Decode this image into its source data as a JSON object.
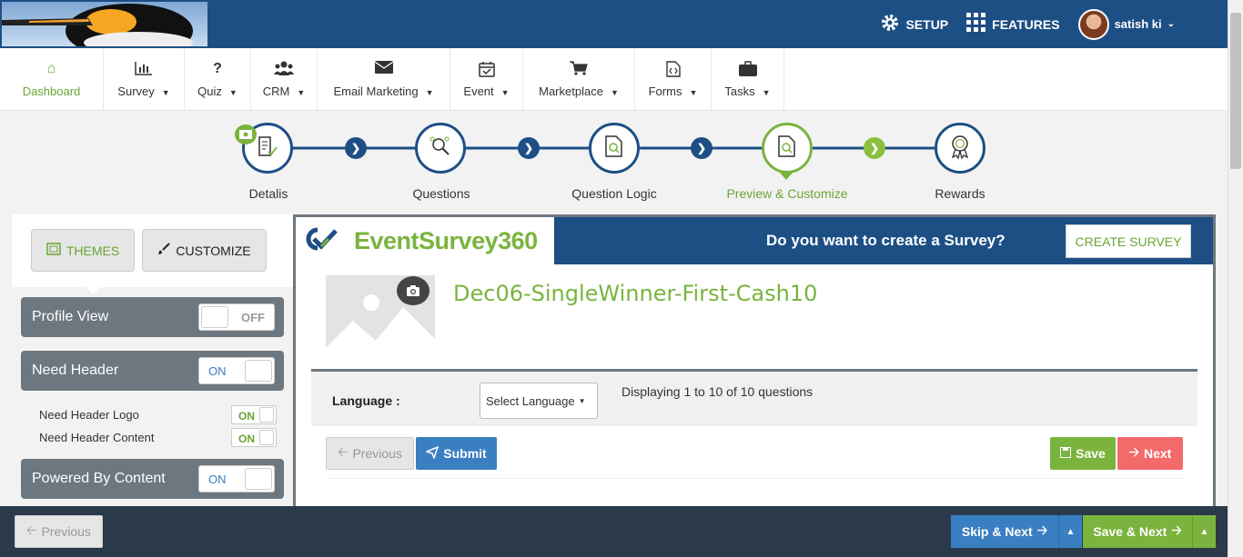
{
  "header": {
    "setup_label": "SETUP",
    "features_label": "FEATURES",
    "user_name": "satish ki"
  },
  "nav": {
    "items": [
      {
        "label": "Dashboard",
        "icon": "home-icon"
      },
      {
        "label": "Survey",
        "icon": "bar-chart-icon"
      },
      {
        "label": "Quiz",
        "icon": "question-icon"
      },
      {
        "label": "CRM",
        "icon": "users-icon"
      },
      {
        "label": "Email Marketing",
        "icon": "envelope-icon"
      },
      {
        "label": "Event",
        "icon": "calendar-check-icon"
      },
      {
        "label": "Marketplace",
        "icon": "cart-icon"
      },
      {
        "label": "Forms",
        "icon": "code-file-icon"
      },
      {
        "label": "Tasks",
        "icon": "briefcase-icon"
      }
    ]
  },
  "steps": [
    {
      "label": "Detalis"
    },
    {
      "label": "Questions"
    },
    {
      "label": "Question Logic"
    },
    {
      "label": "Preview & Customize"
    },
    {
      "label": "Rewards"
    }
  ],
  "left_panel": {
    "tab_themes": "THEMES",
    "tab_customize": "CUSTOMIZE",
    "profile_view": {
      "label": "Profile View",
      "state": "OFF"
    },
    "need_header": {
      "label": "Need Header",
      "state": "ON"
    },
    "need_header_logo": {
      "label": "Need Header Logo",
      "state": "ON"
    },
    "need_header_content": {
      "label": "Need Header Content",
      "state": "ON"
    },
    "powered_by": {
      "label": "Powered By Content",
      "state": "ON"
    }
  },
  "preview": {
    "brand_part1": "EventSur",
    "brand_part2": "vey360",
    "banner_question": "Do you want to create a Survey?",
    "create_survey": "CREATE SURVEY",
    "survey_title": "Dec06-SingleWinner-First-Cash10",
    "language_label": "Language :",
    "language_select": "Select Language",
    "display_text": "Displaying 1 to 10 of 10 questions",
    "previous": "Previous",
    "submit": "Submit",
    "save": "Save",
    "next": "Next"
  },
  "footer": {
    "previous": "Previous",
    "skip_next": "Skip & Next",
    "save_next": "Save & Next"
  },
  "colors": {
    "brand_blue": "#1d4f85",
    "brand_green": "#7ab43e",
    "next_red": "#f26a6a",
    "submit_blue": "#3a7fc1"
  }
}
